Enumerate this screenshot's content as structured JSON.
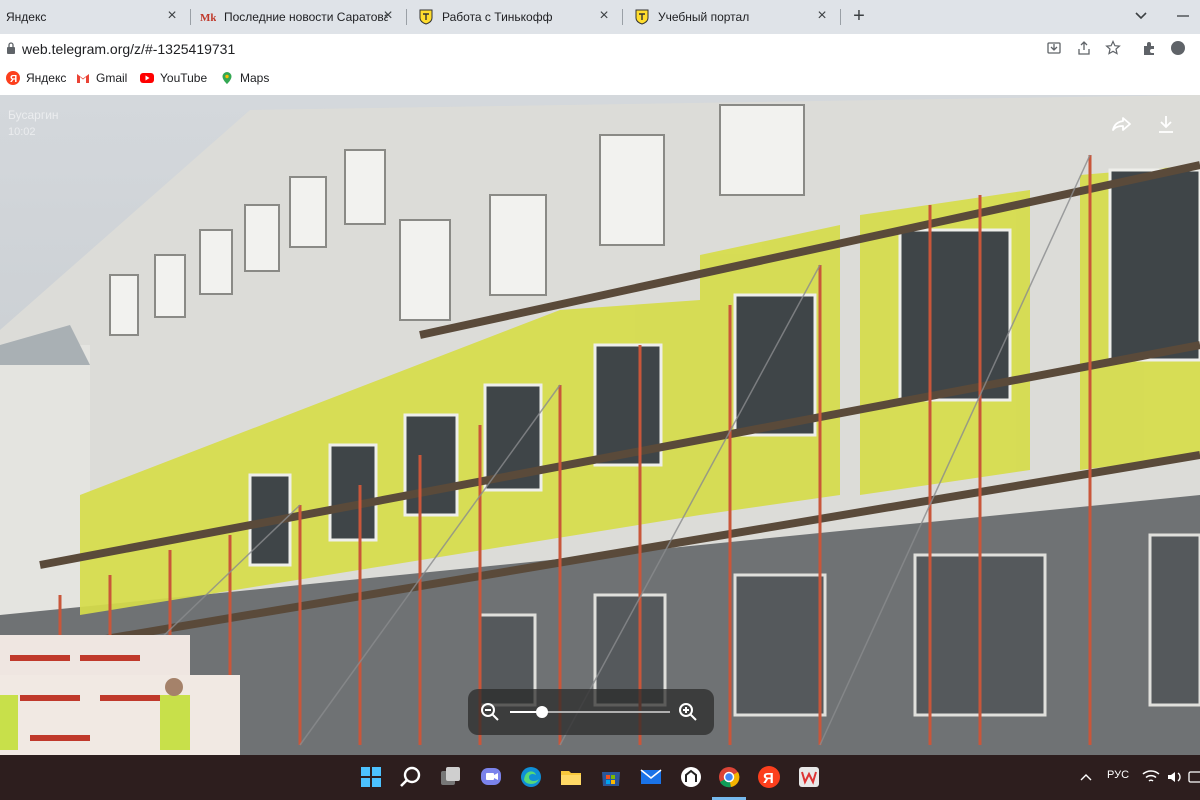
{
  "tabs": [
    {
      "title": "Яндекс",
      "icon": "none"
    },
    {
      "title": "Последние новости Саратова и",
      "icon": "mk-logo"
    },
    {
      "title": "Работа с Тинькофф",
      "icon": "tinkoff-shield"
    },
    {
      "title": "Учебный портал",
      "icon": "tinkoff-shield"
    }
  ],
  "address": {
    "url": "web.telegram.org/z/#-1325419731"
  },
  "bookmarks": [
    {
      "label": "Яндекс",
      "icon": "yandex-icon"
    },
    {
      "label": "Gmail",
      "icon": "gmail-icon"
    },
    {
      "label": "YouTube",
      "icon": "youtube-icon"
    },
    {
      "label": "Maps",
      "icon": "maps-pin-icon"
    }
  ],
  "media": {
    "author": "Бусаргин",
    "time": "10:02",
    "zoom_level": 0.2
  },
  "tray": {
    "language": "РУС"
  },
  "colors": {
    "tab_strip": "#dfe3e8",
    "taskbar": "#2d1e1e",
    "insulation": "#d6dc4a",
    "scaffold": "#c9563a"
  }
}
